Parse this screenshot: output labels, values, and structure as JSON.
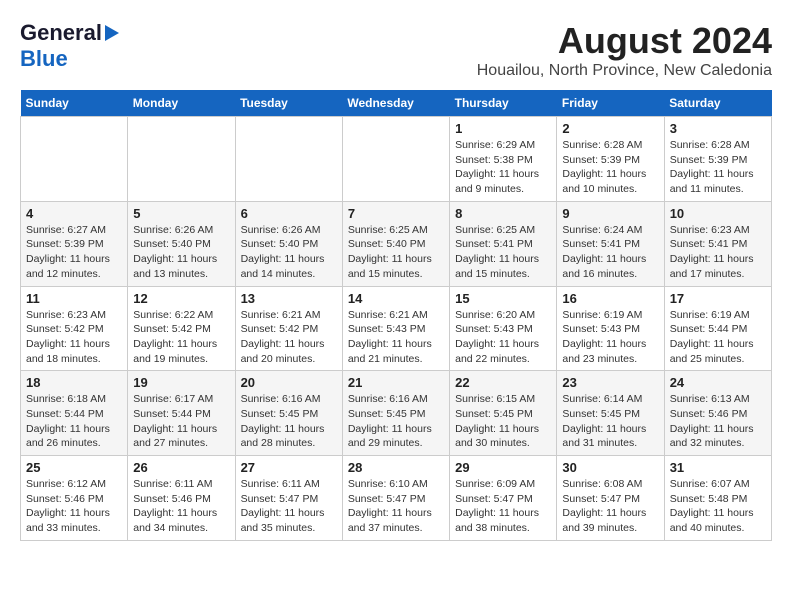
{
  "logo": {
    "line1": "General",
    "line2": "Blue"
  },
  "title": "August 2024",
  "subtitle": "Houailou, North Province, New Caledonia",
  "days_of_week": [
    "Sunday",
    "Monday",
    "Tuesday",
    "Wednesday",
    "Thursday",
    "Friday",
    "Saturday"
  ],
  "weeks": [
    [
      {
        "day": "",
        "info": ""
      },
      {
        "day": "",
        "info": ""
      },
      {
        "day": "",
        "info": ""
      },
      {
        "day": "",
        "info": ""
      },
      {
        "day": "1",
        "sunrise": "6:29 AM",
        "sunset": "5:38 PM",
        "daylight": "11 hours and 9 minutes."
      },
      {
        "day": "2",
        "sunrise": "6:28 AM",
        "sunset": "5:39 PM",
        "daylight": "11 hours and 10 minutes."
      },
      {
        "day": "3",
        "sunrise": "6:28 AM",
        "sunset": "5:39 PM",
        "daylight": "11 hours and 11 minutes."
      }
    ],
    [
      {
        "day": "4",
        "sunrise": "6:27 AM",
        "sunset": "5:39 PM",
        "daylight": "11 hours and 12 minutes."
      },
      {
        "day": "5",
        "sunrise": "6:26 AM",
        "sunset": "5:40 PM",
        "daylight": "11 hours and 13 minutes."
      },
      {
        "day": "6",
        "sunrise": "6:26 AM",
        "sunset": "5:40 PM",
        "daylight": "11 hours and 14 minutes."
      },
      {
        "day": "7",
        "sunrise": "6:25 AM",
        "sunset": "5:40 PM",
        "daylight": "11 hours and 15 minutes."
      },
      {
        "day": "8",
        "sunrise": "6:25 AM",
        "sunset": "5:41 PM",
        "daylight": "11 hours and 15 minutes."
      },
      {
        "day": "9",
        "sunrise": "6:24 AM",
        "sunset": "5:41 PM",
        "daylight": "11 hours and 16 minutes."
      },
      {
        "day": "10",
        "sunrise": "6:23 AM",
        "sunset": "5:41 PM",
        "daylight": "11 hours and 17 minutes."
      }
    ],
    [
      {
        "day": "11",
        "sunrise": "6:23 AM",
        "sunset": "5:42 PM",
        "daylight": "11 hours and 18 minutes."
      },
      {
        "day": "12",
        "sunrise": "6:22 AM",
        "sunset": "5:42 PM",
        "daylight": "11 hours and 19 minutes."
      },
      {
        "day": "13",
        "sunrise": "6:21 AM",
        "sunset": "5:42 PM",
        "daylight": "11 hours and 20 minutes."
      },
      {
        "day": "14",
        "sunrise": "6:21 AM",
        "sunset": "5:43 PM",
        "daylight": "11 hours and 21 minutes."
      },
      {
        "day": "15",
        "sunrise": "6:20 AM",
        "sunset": "5:43 PM",
        "daylight": "11 hours and 22 minutes."
      },
      {
        "day": "16",
        "sunrise": "6:19 AM",
        "sunset": "5:43 PM",
        "daylight": "11 hours and 23 minutes."
      },
      {
        "day": "17",
        "sunrise": "6:19 AM",
        "sunset": "5:44 PM",
        "daylight": "11 hours and 25 minutes."
      }
    ],
    [
      {
        "day": "18",
        "sunrise": "6:18 AM",
        "sunset": "5:44 PM",
        "daylight": "11 hours and 26 minutes."
      },
      {
        "day": "19",
        "sunrise": "6:17 AM",
        "sunset": "5:44 PM",
        "daylight": "11 hours and 27 minutes."
      },
      {
        "day": "20",
        "sunrise": "6:16 AM",
        "sunset": "5:45 PM",
        "daylight": "11 hours and 28 minutes."
      },
      {
        "day": "21",
        "sunrise": "6:16 AM",
        "sunset": "5:45 PM",
        "daylight": "11 hours and 29 minutes."
      },
      {
        "day": "22",
        "sunrise": "6:15 AM",
        "sunset": "5:45 PM",
        "daylight": "11 hours and 30 minutes."
      },
      {
        "day": "23",
        "sunrise": "6:14 AM",
        "sunset": "5:45 PM",
        "daylight": "11 hours and 31 minutes."
      },
      {
        "day": "24",
        "sunrise": "6:13 AM",
        "sunset": "5:46 PM",
        "daylight": "11 hours and 32 minutes."
      }
    ],
    [
      {
        "day": "25",
        "sunrise": "6:12 AM",
        "sunset": "5:46 PM",
        "daylight": "11 hours and 33 minutes."
      },
      {
        "day": "26",
        "sunrise": "6:11 AM",
        "sunset": "5:46 PM",
        "daylight": "11 hours and 34 minutes."
      },
      {
        "day": "27",
        "sunrise": "6:11 AM",
        "sunset": "5:47 PM",
        "daylight": "11 hours and 35 minutes."
      },
      {
        "day": "28",
        "sunrise": "6:10 AM",
        "sunset": "5:47 PM",
        "daylight": "11 hours and 37 minutes."
      },
      {
        "day": "29",
        "sunrise": "6:09 AM",
        "sunset": "5:47 PM",
        "daylight": "11 hours and 38 minutes."
      },
      {
        "day": "30",
        "sunrise": "6:08 AM",
        "sunset": "5:47 PM",
        "daylight": "11 hours and 39 minutes."
      },
      {
        "day": "31",
        "sunrise": "6:07 AM",
        "sunset": "5:48 PM",
        "daylight": "11 hours and 40 minutes."
      }
    ]
  ]
}
